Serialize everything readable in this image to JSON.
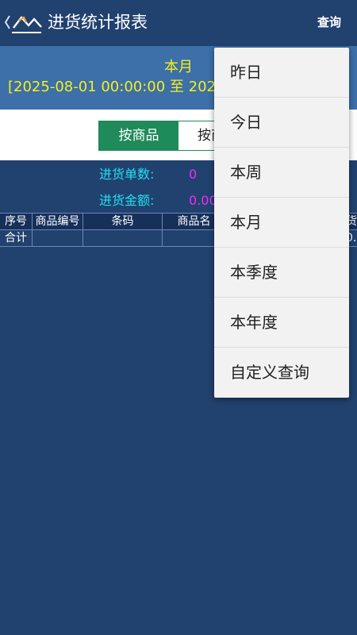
{
  "header": {
    "title": "进货统计报表",
    "query_label": "查询"
  },
  "period": {
    "title": "本月",
    "range_text": "[2025-08-01 00:00:00 至 202"
  },
  "tabs": [
    {
      "label": "按商品",
      "active": true
    },
    {
      "label": "按商",
      "active": false
    }
  ],
  "summary": {
    "count_label": "进货单数:",
    "count_value": "0",
    "amount_label": "进货金额:",
    "amount_value": "0.00"
  },
  "table": {
    "columns": [
      "序号",
      "商品编号",
      "条码",
      "商品名",
      "货"
    ],
    "total_row": {
      "label": "合计",
      "last_value": "0.0"
    }
  },
  "menu": {
    "items": [
      "昨日",
      "今日",
      "本周",
      "本月",
      "本季度",
      "本年度",
      "自定义查询"
    ]
  },
  "colors": {
    "header_bg": "#21416f",
    "date_band_bg": "#3d6fa8",
    "highlight_yellow": "#f4f01e",
    "active_tab_green": "#1f8a5a",
    "label_cyan": "#1fe1f0",
    "value_magenta": "#ef2ef6",
    "menu_bg": "#f2f2f2"
  }
}
